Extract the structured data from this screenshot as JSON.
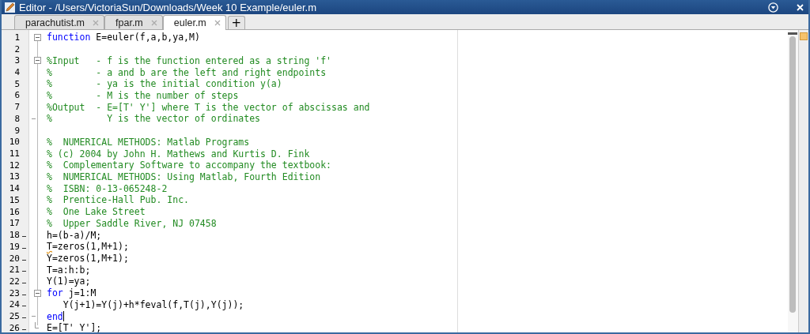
{
  "window": {
    "title": "Editor - /Users/VictoriaSun/Downloads/Week 10 Example/euler.m"
  },
  "tabs": [
    {
      "label": "parachutist.m",
      "selected": false
    },
    {
      "label": "fpar.m",
      "selected": false
    },
    {
      "label": "euler.m",
      "selected": true
    }
  ],
  "new_tab": "+",
  "lines": [
    {
      "number": "1",
      "executable": false,
      "fold": {
        "kind": "box"
      },
      "segments": [
        {
          "text": "function",
          "kind": "keyword"
        },
        {
          "text": " E=euler(f,a,b,ya,M)",
          "kind": "plain"
        }
      ]
    },
    {
      "number": "2",
      "executable": false
    },
    {
      "number": "3",
      "executable": false,
      "fold": {
        "kind": "box"
      },
      "segments": [
        {
          "text": "%Input   - f is the function entered as a string 'f'",
          "kind": "comment"
        }
      ]
    },
    {
      "number": "4",
      "executable": false,
      "segments": [
        {
          "text": "%        - a and b are the left and right endpoints",
          "kind": "comment"
        }
      ]
    },
    {
      "number": "5",
      "executable": false,
      "segments": [
        {
          "text": "%        - ya is the initial condition y(a)",
          "kind": "comment"
        }
      ]
    },
    {
      "number": "6",
      "executable": false,
      "segments": [
        {
          "text": "%        - M is the number of steps",
          "kind": "comment"
        }
      ]
    },
    {
      "number": "7",
      "executable": false,
      "segments": [
        {
          "text": "%Output  - E=[T' Y'] where T is the vector of abscissas and",
          "kind": "comment"
        }
      ]
    },
    {
      "number": "8",
      "executable": false,
      "fold": {
        "kind": "tick"
      },
      "segments": [
        {
          "text": "%          Y is the vector of ordinates",
          "kind": "comment"
        }
      ]
    },
    {
      "number": "9",
      "executable": false
    },
    {
      "number": "10",
      "executable": false,
      "segments": [
        {
          "text": "%  NUMERICAL METHODS: Matlab Programs",
          "kind": "comment"
        }
      ]
    },
    {
      "number": "11",
      "executable": false,
      "segments": [
        {
          "text": "% (c) 2004 by John H. Mathews and Kurtis D. Fink",
          "kind": "comment"
        }
      ]
    },
    {
      "number": "12",
      "executable": false,
      "segments": [
        {
          "text": "%  Complementary Software to accompany the textbook:",
          "kind": "comment"
        }
      ]
    },
    {
      "number": "13",
      "executable": false,
      "segments": [
        {
          "text": "%  NUMERICAL METHODS: Using Matlab, Fourth Edition",
          "kind": "comment"
        }
      ]
    },
    {
      "number": "14",
      "executable": false,
      "segments": [
        {
          "text": "%  ISBN: 0-13-065248-2",
          "kind": "comment"
        }
      ]
    },
    {
      "number": "15",
      "executable": false,
      "segments": [
        {
          "text": "%  Prentice-Hall Pub. Inc.",
          "kind": "comment"
        }
      ]
    },
    {
      "number": "16",
      "executable": false,
      "segments": [
        {
          "text": "%  One Lake Street",
          "kind": "comment"
        }
      ]
    },
    {
      "number": "17",
      "executable": false,
      "segments": [
        {
          "text": "%  Upper Saddle River, NJ 07458",
          "kind": "comment"
        }
      ]
    },
    {
      "number": "18",
      "executable": true,
      "segments": [
        {
          "text": "h=(b-a)/M;",
          "kind": "plain"
        }
      ]
    },
    {
      "number": "19",
      "executable": true,
      "segments": [
        {
          "text": "T",
          "kind": "warning"
        },
        {
          "text": "=zeros(1,M+1);",
          "kind": "plain"
        }
      ]
    },
    {
      "number": "20",
      "executable": true,
      "segments": [
        {
          "text": "Y=zeros(1,M+1);",
          "kind": "plain"
        }
      ]
    },
    {
      "number": "21",
      "executable": true,
      "segments": [
        {
          "text": "T=a:h:b;",
          "kind": "plain"
        }
      ]
    },
    {
      "number": "22",
      "executable": true,
      "segments": [
        {
          "text": "Y(1)=ya;",
          "kind": "plain"
        }
      ]
    },
    {
      "number": "23",
      "executable": true,
      "fold": {
        "kind": "box"
      },
      "segments": [
        {
          "text": "for",
          "kind": "keyword"
        },
        {
          "text": " j=1:M",
          "kind": "plain"
        }
      ]
    },
    {
      "number": "24",
      "executable": true,
      "segments": [
        {
          "text": "   Y(j+1)=Y(j)+h*feval(f,T(j),Y(j));",
          "kind": "plain"
        }
      ]
    },
    {
      "number": "25",
      "executable": true,
      "fold": {
        "kind": "tick"
      },
      "cursor": true,
      "segments": [
        {
          "text": "end",
          "kind": "keyword"
        }
      ]
    },
    {
      "number": "26",
      "executable": true,
      "fold": {
        "kind": "end"
      },
      "segments": [
        {
          "text": "E=[T' Y'];",
          "kind": "plain"
        }
      ]
    }
  ]
}
